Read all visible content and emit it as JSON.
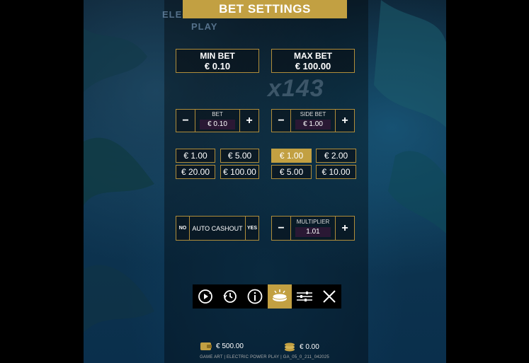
{
  "header": {
    "title": "BET SETTINGS"
  },
  "background": {
    "logo_top": "ELECT",
    "logo_bottom": "PLAY",
    "multiplier_art": "x143"
  },
  "limits": {
    "min_bet": {
      "label": "MIN BET",
      "value": "€ 0.10"
    },
    "max_bet": {
      "label": "MAX BET",
      "value": "€ 100.00"
    }
  },
  "bet": {
    "caption": "BET",
    "value": "€ 0.10",
    "minus": "−",
    "plus": "+"
  },
  "side_bet": {
    "caption": "SIDE BET",
    "value": "€ 1.00",
    "minus": "−",
    "plus": "+"
  },
  "bet_chips": [
    "€ 1.00",
    "€ 5.00",
    "€ 20.00",
    "€ 100.00"
  ],
  "side_bet_chips": [
    "€ 1.00",
    "€ 2.00",
    "€ 5.00",
    "€ 10.00"
  ],
  "side_bet_selected": "€ 1.00",
  "auto_cashout": {
    "no": "NO",
    "label": "AUTO CASHOUT",
    "yes": "YES"
  },
  "multiplier": {
    "caption": "MULTIPLIER",
    "value": "1.01",
    "minus": "−",
    "plus": "+"
  },
  "toolbar": {
    "items": [
      "autoplay-icon",
      "history-icon",
      "info-icon",
      "bet-settings-icon",
      "settings-icon",
      "close-icon"
    ],
    "active": "bet-settings-icon"
  },
  "footer": {
    "balance": "€ 500.00",
    "total_bet": "€ 0.00",
    "build": "GAME ART | ELECTRIC POWER PLAY | GA_05_0_211_042025"
  },
  "colors": {
    "accent": "#c2a042",
    "border": "#b08d3a",
    "value_bg": "#2a1834"
  }
}
